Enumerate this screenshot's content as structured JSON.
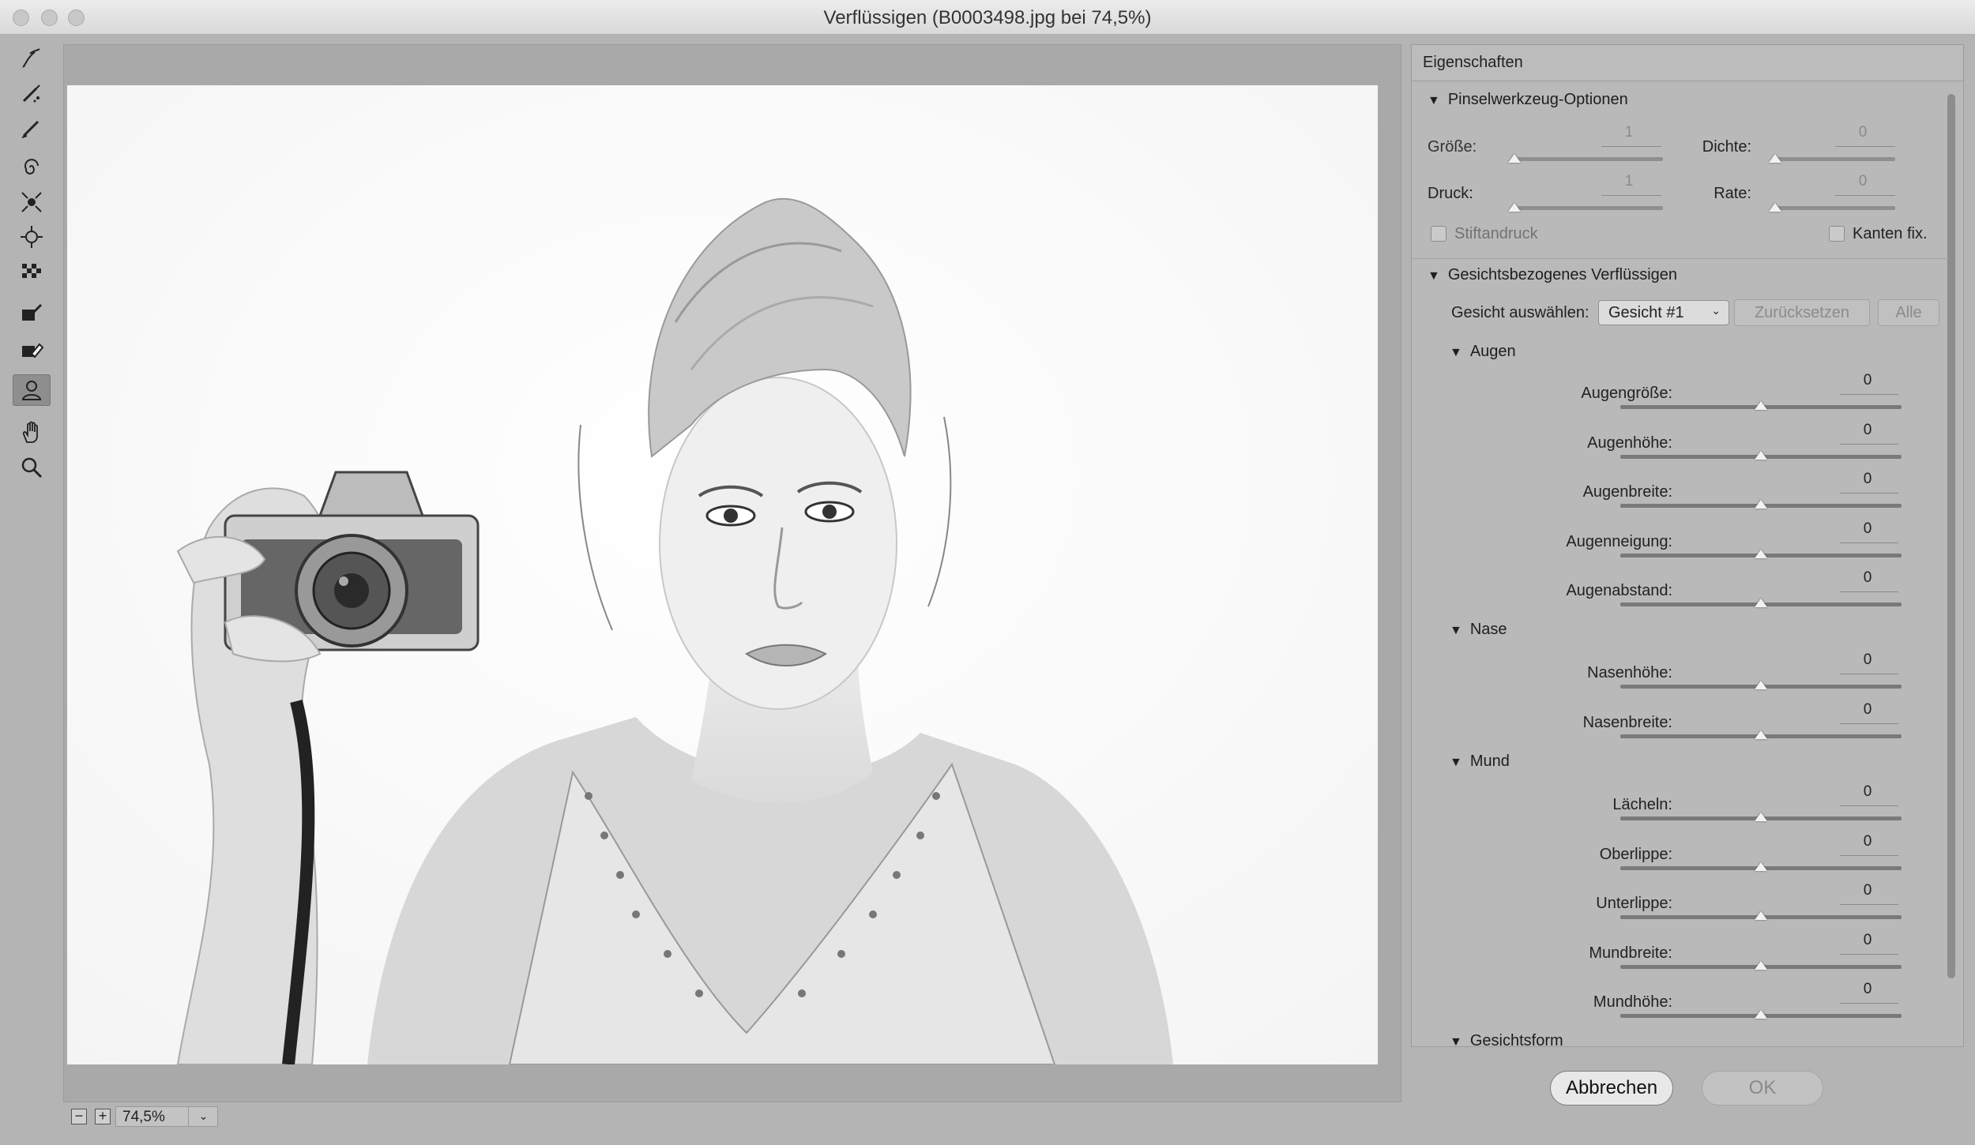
{
  "window": {
    "title": "Verflüssigen (B0003498.jpg bei 74,5%)"
  },
  "toolbar": {
    "tools": [
      {
        "name": "forward-warp-tool-icon"
      },
      {
        "name": "reconstruct-tool-icon"
      },
      {
        "name": "smooth-tool-icon"
      },
      {
        "name": "twirl-tool-icon"
      },
      {
        "name": "pucker-tool-icon"
      },
      {
        "name": "bloat-tool-icon"
      },
      {
        "name": "push-left-tool-icon"
      },
      {
        "name": "freeze-mask-tool-icon"
      },
      {
        "name": "thaw-mask-tool-icon"
      },
      {
        "name": "face-tool-icon",
        "active": true
      },
      {
        "name": "hand-tool-icon"
      },
      {
        "name": "zoom-tool-icon"
      }
    ]
  },
  "statusbar": {
    "zoom_out": "−",
    "zoom_in": "+",
    "zoom_value": "74,5%"
  },
  "panel": {
    "title": "Eigenschaften",
    "brush": {
      "heading": "Pinselwerkzeug-Optionen",
      "size_label": "Größe:",
      "size_value": "1",
      "density_label": "Dichte:",
      "density_value": "0",
      "pressure_label": "Druck:",
      "pressure_value": "1",
      "rate_label": "Rate:",
      "rate_value": "0",
      "stylus_label": "Stiftandruck",
      "pin_edges_label": "Kanten fix."
    },
    "face": {
      "heading": "Gesichtsbezogenes Verflüssigen",
      "select_label": "Gesicht auswählen:",
      "select_value": "Gesicht #1",
      "reset_label": "Zurücksetzen",
      "all_label": "Alle",
      "eyes": {
        "heading": "Augen",
        "sliders": [
          {
            "label": "Augengröße:",
            "value": "0"
          },
          {
            "label": "Augenhöhe:",
            "value": "0"
          },
          {
            "label": "Augenbreite:",
            "value": "0"
          },
          {
            "label": "Augenneigung:",
            "value": "0"
          },
          {
            "label": "Augenabstand:",
            "value": "0"
          }
        ]
      },
      "nose": {
        "heading": "Nase",
        "sliders": [
          {
            "label": "Nasenhöhe:",
            "value": "0"
          },
          {
            "label": "Nasenbreite:",
            "value": "0"
          }
        ]
      },
      "mouth": {
        "heading": "Mund",
        "sliders": [
          {
            "label": "Lächeln:",
            "value": "0"
          },
          {
            "label": "Oberlippe:",
            "value": "0"
          },
          {
            "label": "Unterlippe:",
            "value": "0"
          },
          {
            "label": "Mundbreite:",
            "value": "0"
          },
          {
            "label": "Mundhöhe:",
            "value": "0"
          }
        ]
      },
      "face_shape": {
        "heading": "Gesichtsform"
      }
    }
  },
  "buttons": {
    "cancel": "Abbrechen",
    "ok": "OK"
  }
}
